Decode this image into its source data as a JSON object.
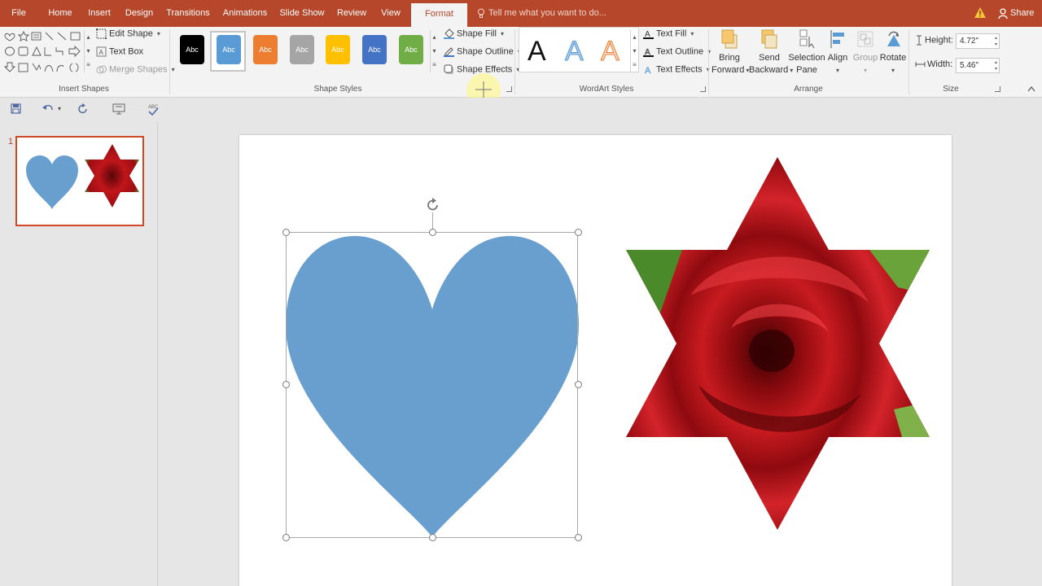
{
  "tabs": [
    {
      "label": "File"
    },
    {
      "label": "Home"
    },
    {
      "label": "Insert"
    },
    {
      "label": "Design"
    },
    {
      "label": "Transitions"
    },
    {
      "label": "Animations"
    },
    {
      "label": "Slide Show"
    },
    {
      "label": "Review"
    },
    {
      "label": "View"
    },
    {
      "label": "Format"
    }
  ],
  "active_tab": "Format",
  "tell_me": "Tell me what you want to do...",
  "share_label": "Share",
  "insert_shapes": {
    "edit_shape": "Edit Shape",
    "text_box": "Text Box",
    "merge_shapes": "Merge Shapes",
    "label": "Insert Shapes"
  },
  "shape_styles": {
    "swatch_text": "Abc",
    "swatches": [
      {
        "color": "#000000"
      },
      {
        "color": "#5b9bd5"
      },
      {
        "color": "#ed7d31"
      },
      {
        "color": "#a5a5a5"
      },
      {
        "color": "#ffc000"
      },
      {
        "color": "#4472c4"
      },
      {
        "color": "#70ad47"
      }
    ],
    "shape_fill": "Shape Fill",
    "shape_outline": "Shape Outline",
    "shape_effects": "Shape Effects",
    "label": "Shape Styles"
  },
  "wordart_styles": {
    "sample_letter": "A",
    "text_fill": "Text Fill",
    "text_outline": "Text Outline",
    "text_effects": "Text Effects",
    "label": "WordArt Styles"
  },
  "arrange": {
    "bring_forward_1": "Bring",
    "bring_forward_2": "Forward",
    "send_backward_1": "Send",
    "send_backward_2": "Backward",
    "selection_pane_1": "Selection",
    "selection_pane_2": "Pane",
    "align": "Align",
    "group": "Group",
    "rotate": "Rotate",
    "label": "Arrange"
  },
  "size": {
    "height_label": "Height:",
    "height_value": "4.72\"",
    "width_label": "Width:",
    "width_value": "5.46\"",
    "label": "Size"
  },
  "thumbnail": {
    "slide_number": "1"
  },
  "colors": {
    "accent": "#b7472a",
    "heart_fill": "#699fcf",
    "rose_dark": "#7a0a0c",
    "rose_mid": "#c0161b",
    "leaf": "#4b8a2a"
  }
}
